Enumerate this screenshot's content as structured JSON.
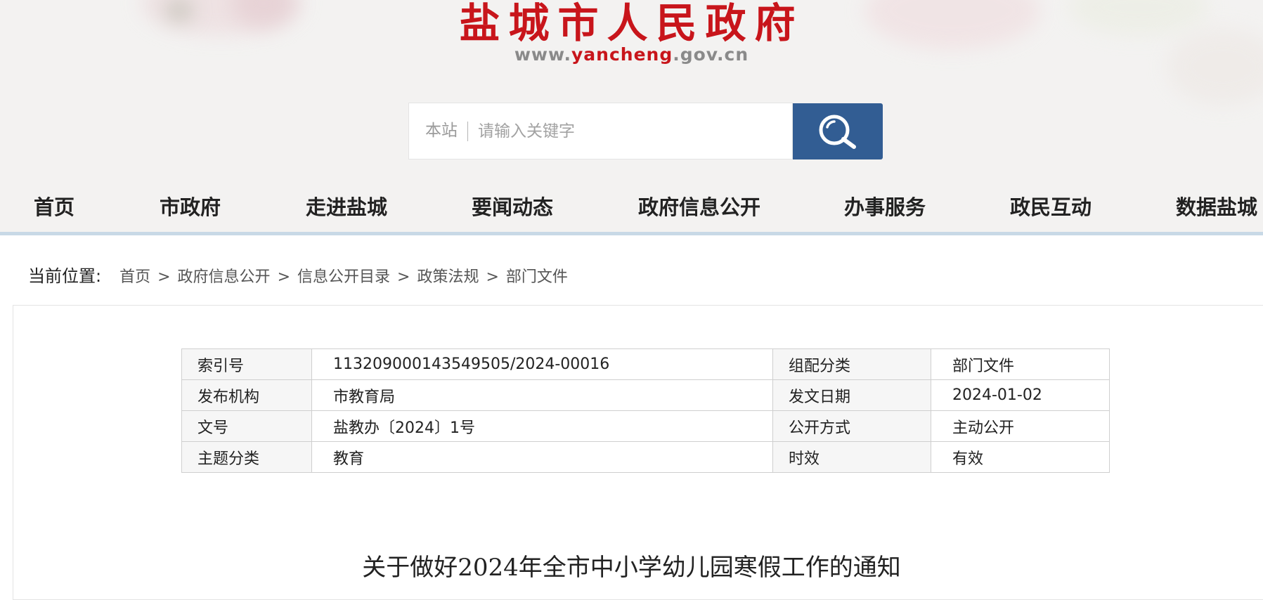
{
  "header": {
    "title": "盐城市人民政府",
    "domain_prefix": "www.",
    "domain_highlight": "yancheng",
    "domain_suffix": ".gov.cn"
  },
  "search": {
    "scope": "本站",
    "placeholder": "请输入关键字",
    "button_icon": "search-icon"
  },
  "nav": {
    "items": [
      "首页",
      "市政府",
      "走进盐城",
      "要闻动态",
      "政府信息公开",
      "办事服务",
      "政民互动",
      "数据盐城"
    ]
  },
  "breadcrumb": {
    "label": "当前位置:",
    "items": [
      "首页",
      "政府信息公开",
      "信息公开目录",
      "政策法规",
      "部门文件"
    ],
    "separator": ">"
  },
  "meta": {
    "rows": [
      {
        "l1": "索引号",
        "v1": "113209000143549505/2024-00016",
        "l2": "组配分类",
        "v2": "部门文件"
      },
      {
        "l1": "发布机构",
        "v1": "市教育局",
        "l2": "发文日期",
        "v2": "2024-01-02"
      },
      {
        "l1": "文号",
        "v1": "盐教办〔2024〕1号",
        "l2": "公开方式",
        "v2": "主动公开"
      },
      {
        "l1": "主题分类",
        "v1": "教育",
        "l2": "时效",
        "v2": "有效"
      }
    ]
  },
  "document": {
    "title": "关于做好2024年全市中小学幼儿园寒假工作的通知"
  },
  "colors": {
    "brand_red": "#c8151b",
    "search_button": "#325d93",
    "header_bg": "#f3f2f1"
  }
}
